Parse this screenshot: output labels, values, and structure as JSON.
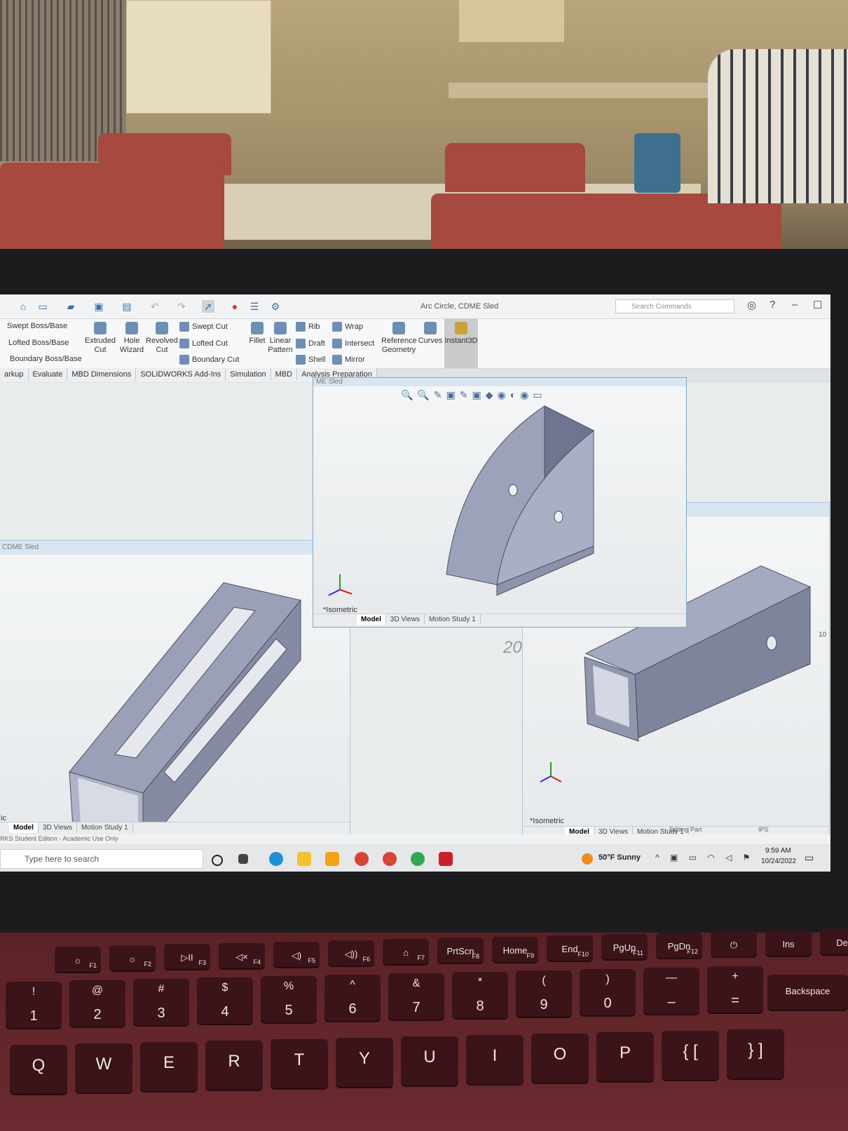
{
  "window": {
    "title": "Arc Circle, CDME Sled",
    "search_placeholder": "Search Commands"
  },
  "ribbon": {
    "features_left": [
      "Swept Boss/Base",
      "Lofted Boss/Base",
      "Boundary Boss/Base"
    ],
    "extruded_cut": "Extruded Cut",
    "hole_wizard": "Hole Wizard",
    "revolved_cut": "Revolved Cut",
    "cut_features": [
      "Swept Cut",
      "Lofted Cut",
      "Boundary Cut"
    ],
    "fillet": "Fillet",
    "linear_pattern": "Linear Pattern",
    "mid_features": [
      "Rib",
      "Draft",
      "Shell"
    ],
    "right_features": [
      "Wrap",
      "Intersect",
      "Mirror"
    ],
    "reference_geometry": "Reference Geometry",
    "curves": "Curves",
    "instant3d": "Instant3D"
  },
  "command_tabs": [
    "arkup",
    "Evaluate",
    "MBD Dimensions",
    "SOLIDWORKS Add-Ins",
    "Simulation",
    "MBD",
    "Analysis Preparation"
  ],
  "viewports": {
    "top": {
      "header": "ME Sled",
      "orientation": "*Isometric",
      "tabs": [
        "Model",
        "3D Views",
        "Motion Study 1"
      ]
    },
    "left": {
      "header": "CDME Sled",
      "orientation": "ic",
      "tabs": [
        "Model",
        "3D Views",
        "Motion Study 1"
      ]
    },
    "right": {
      "orientation": "*Isometric",
      "tabs": [
        "Model",
        "3D Views",
        "Motion Study 1"
      ]
    },
    "middle_number": "20",
    "edge_number": "10"
  },
  "status": {
    "edition": "RKS Student Edition - Academic Use Only",
    "mode": "Editing Part",
    "units": "IPS"
  },
  "taskbar": {
    "search_placeholder": "Type here to search",
    "weather": "50°F  Sunny",
    "time": "9:59 AM",
    "date": "10/24/2022"
  },
  "keyboard": {
    "fn_row": [
      {
        "top": "☼",
        "fn": "F1"
      },
      {
        "top": "☼",
        "fn": "F2"
      },
      {
        "top": "▷II",
        "fn": "F3"
      },
      {
        "top": "◁×",
        "fn": "F4"
      },
      {
        "top": "◁)",
        "fn": "F5"
      },
      {
        "top": "◁))",
        "fn": "F6"
      },
      {
        "top": "⌂",
        "fn": "F7"
      },
      {
        "top": "PrtScn",
        "fn": "F8"
      },
      {
        "top": "Home",
        "fn": "F9"
      },
      {
        "top": "End",
        "fn": "F10"
      },
      {
        "top": "PgUp",
        "fn": "F11"
      },
      {
        "top": "PgDn",
        "fn": "F12"
      },
      {
        "top": "⏻",
        "fn": ""
      },
      {
        "top": "Ins",
        "fn": ""
      },
      {
        "top": "Del",
        "fn": ""
      }
    ],
    "num_row": [
      {
        "top": "!",
        "bottom": "1"
      },
      {
        "top": "@",
        "bottom": "2"
      },
      {
        "top": "#",
        "bottom": "3"
      },
      {
        "top": "$",
        "bottom": "4"
      },
      {
        "top": "%",
        "bottom": "5"
      },
      {
        "top": "^",
        "bottom": "6"
      },
      {
        "top": "&",
        "bottom": "7"
      },
      {
        "top": "*",
        "bottom": "8"
      },
      {
        "top": "(",
        "bottom": "9"
      },
      {
        "top": ")",
        "bottom": "0"
      },
      {
        "top": "—",
        "bottom": "–"
      },
      {
        "top": "+",
        "bottom": "="
      }
    ],
    "backspace": "Backspace",
    "letter_row": [
      "Q",
      "W",
      "E",
      "R",
      "T",
      "Y",
      "U",
      "I",
      "O",
      "P",
      "{ [",
      "} ]"
    ]
  }
}
